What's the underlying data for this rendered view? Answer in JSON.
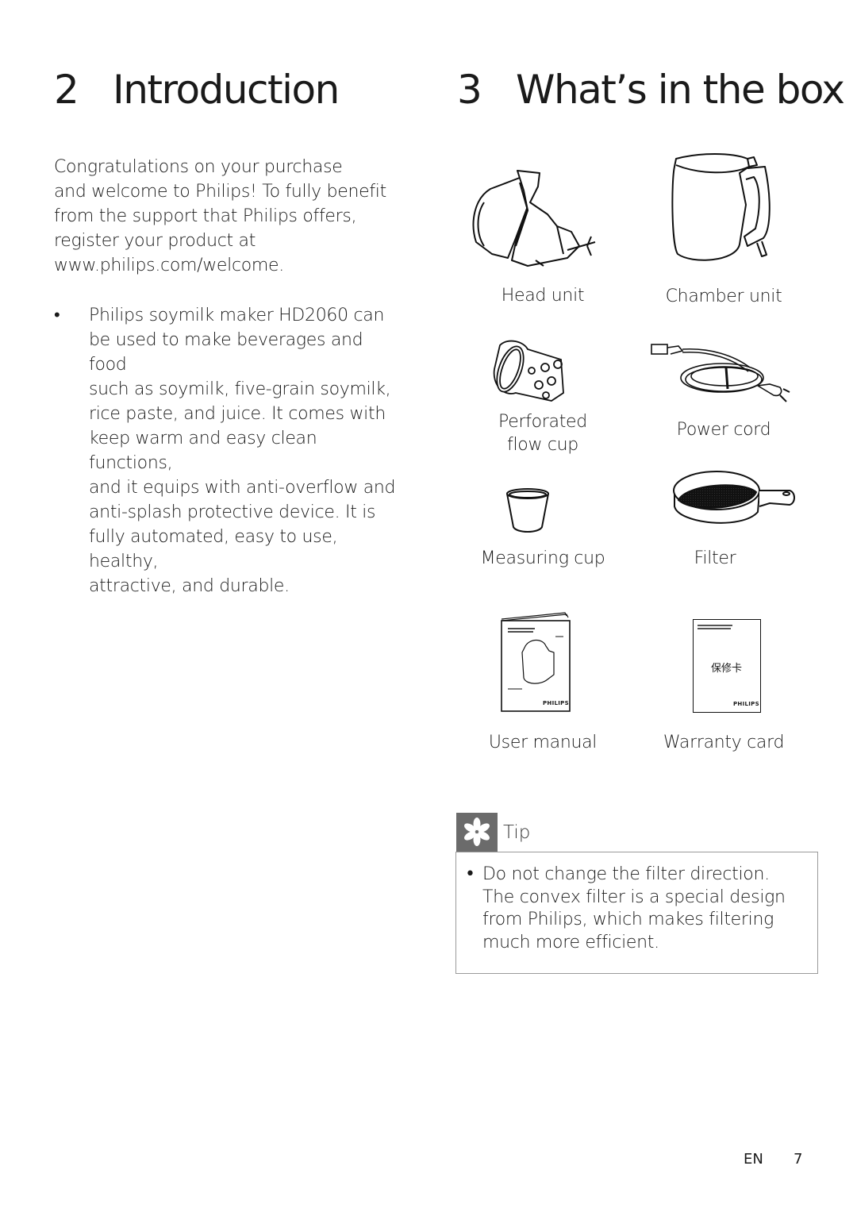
{
  "sections": {
    "introduction": {
      "number": "2",
      "title": "Introduction",
      "intro_lines": [
        "Congratulations on your purchase",
        "and welcome to Philips! To fully benefit",
        "from the support that Philips offers,",
        "register your product at",
        "www.philips.com/welcome."
      ],
      "bullet_symbol": "•",
      "bullet_lines": [
        "Philips soymilk maker HD2060 can",
        "be used to make beverages and food",
        "such as soymilk, five-grain soymilk,",
        "rice paste, and juice. It comes with",
        "keep warm and easy clean functions,",
        "and it equips with anti-overflow and",
        "anti-splash protective device. It is",
        "fully automated, easy to use, healthy,",
        "attractive, and durable."
      ]
    },
    "whats_in_the_box": {
      "number": "3",
      "title": "What’s in the box",
      "items": [
        {
          "label": "Head unit",
          "icon": "head-unit-illustration"
        },
        {
          "label": "Chamber unit",
          "icon": "chamber-unit-illustration"
        },
        {
          "label_lines": [
            "Perforated",
            "flow cup"
          ],
          "icon": "perforated-flow-cup-illustration"
        },
        {
          "label": "Power cord",
          "icon": "power-cord-illustration"
        },
        {
          "label": "Measuring cup",
          "icon": "measuring-cup-illustration"
        },
        {
          "label": "Filter",
          "icon": "filter-illustration"
        },
        {
          "label": "User manual",
          "icon": "user-manual-illustration",
          "brand_text": "PHILIPS"
        },
        {
          "label": "Warranty card",
          "icon": "warranty-card-illustration",
          "brand_text": "PHILIPS",
          "card_text": "保修卡"
        }
      ]
    },
    "tip": {
      "icon": "asterisk-icon",
      "label": "Tip",
      "bullet_symbol": "•",
      "lines": [
        "Do not change the filter direction.",
        "The convex filter is a special design",
        "from Philips, which makes filtering",
        "much more efficient."
      ],
      "badge_color": "#6b6b6b",
      "border_color": "#9a9a9a"
    }
  },
  "footer": {
    "language": "EN",
    "page_number": "7"
  }
}
